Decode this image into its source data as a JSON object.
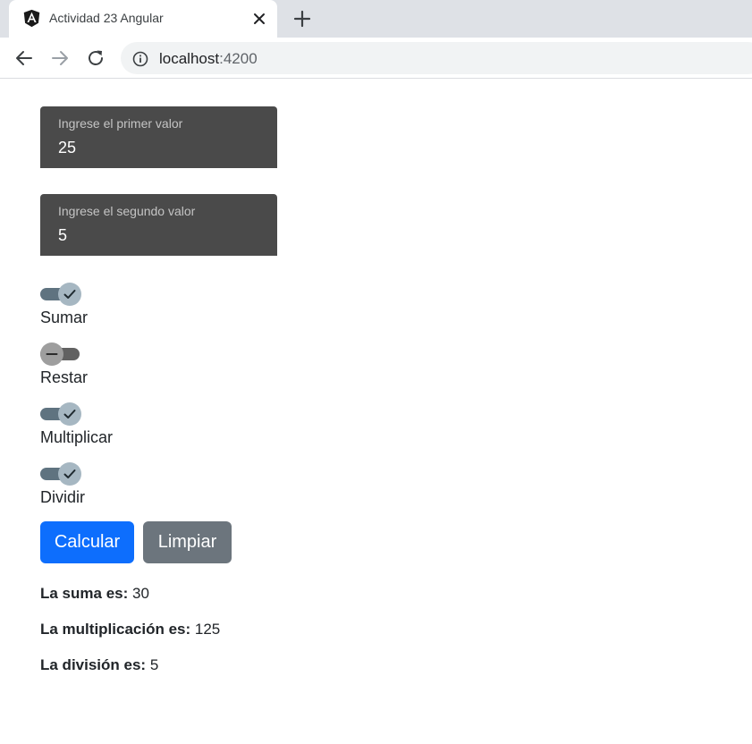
{
  "browser": {
    "tab_title": "Actividad 23 Angular",
    "url_host": "localhost",
    "url_port": ":4200"
  },
  "form": {
    "first_label": "Ingrese el primer valor",
    "first_value": "25",
    "second_label": "Ingrese el segundo valor",
    "second_value": "5"
  },
  "operations": [
    {
      "label": "Sumar",
      "checked": true
    },
    {
      "label": "Restar",
      "checked": false
    },
    {
      "label": "Multiplicar",
      "checked": true
    },
    {
      "label": "Dividir",
      "checked": true
    }
  ],
  "buttons": {
    "calculate": "Calcular",
    "clear": "Limpiar"
  },
  "results": [
    {
      "label": "La suma es:",
      "value": "30"
    },
    {
      "label": "La multiplicación es:",
      "value": "125"
    },
    {
      "label": "La división es:",
      "value": "5"
    }
  ],
  "colors": {
    "primary": "#0d6efd",
    "secondary": "#6c757d",
    "field_bg": "#4a4a4a",
    "toggle_on": "#5f7380",
    "toggle_off": "#616161"
  },
  "icons": [
    "angular-logo-icon",
    "close-icon",
    "plus-icon",
    "back-arrow-icon",
    "forward-arrow-icon",
    "reload-icon",
    "info-icon",
    "check-icon",
    "minus-icon"
  ]
}
